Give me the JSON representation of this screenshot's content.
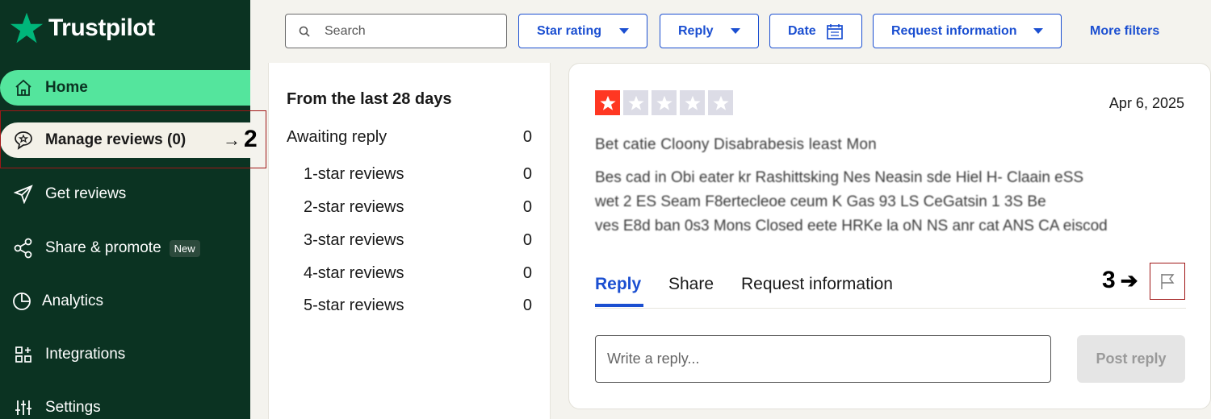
{
  "brand": {
    "name": "Trustpilot",
    "color": "#00b67a"
  },
  "sidebar": {
    "items": [
      {
        "label": "Home",
        "icon": "home-icon"
      },
      {
        "label": "Manage reviews (0)",
        "icon": "review-bubble-icon"
      },
      {
        "label": "Get reviews",
        "icon": "send-icon"
      },
      {
        "label": "Share & promote",
        "icon": "share-icon",
        "badge": "New"
      },
      {
        "label": "Analytics",
        "icon": "pie-chart-icon"
      },
      {
        "label": "Integrations",
        "icon": "grid-icon"
      },
      {
        "label": "Settings",
        "icon": "sliders-icon"
      }
    ],
    "active_color": "#54e59d"
  },
  "annotations": {
    "two": "2",
    "three": "3"
  },
  "filters": {
    "search_placeholder": "Search",
    "star_rating": "Star rating",
    "reply": "Reply",
    "date": "Date",
    "request_information": "Request information",
    "more_filters": "More filters",
    "accent": "#1b4fd1"
  },
  "stats": {
    "title": "From the last 28 days",
    "rows": [
      {
        "label": "Awaiting reply",
        "value": "0"
      },
      {
        "label": "1-star reviews",
        "value": "0"
      },
      {
        "label": "2-star reviews",
        "value": "0"
      },
      {
        "label": "3-star reviews",
        "value": "0"
      },
      {
        "label": "4-star reviews",
        "value": "0"
      },
      {
        "label": "5-star reviews",
        "value": "0"
      }
    ]
  },
  "review": {
    "rating": 1,
    "max_rating": 5,
    "date": "Apr 6, 2025",
    "title": "Bet catie Cloony Disabrabesis least Mon",
    "body": [
      "Bes cad in Obi eater kr Rashittsking Nes Neasin sde Hiel H-      Claain eSS",
      "wet 2 ES Seam F8ertecleoe ceum K Gas 93 LS CeGatsin 1 3S Be",
      "ves E8d ban 0s3 Mons Closed eete HRKe la oN NS anr cat ANS CA eiscod"
    ]
  },
  "review_tabs": {
    "reply": "Reply",
    "share": "Share",
    "request_information": "Request information"
  },
  "reply_box": {
    "placeholder": "Write a reply...",
    "post_label": "Post reply"
  }
}
